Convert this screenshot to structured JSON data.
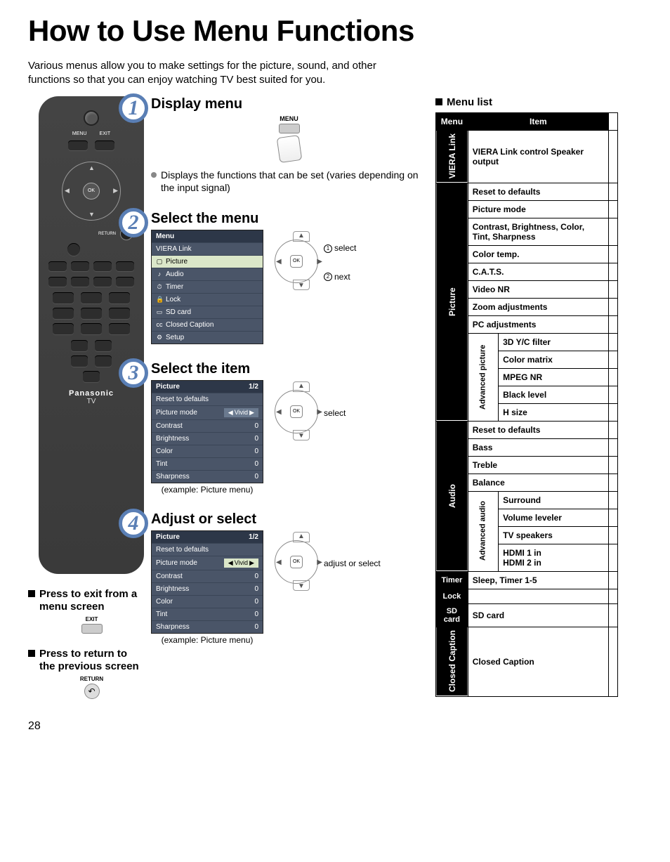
{
  "title": "How to Use Menu Functions",
  "intro": "Various menus allow you to make settings for the picture, sound, and other functions so that you can enjoy watching TV best suited for you.",
  "page_number": "28",
  "remote": {
    "menu_label": "MENU",
    "exit_label": "EXIT",
    "ok_label": "OK",
    "return_label": "RETURN",
    "brand": "Panasonic",
    "sub": "TV"
  },
  "notes": {
    "exit": {
      "text": "Press to exit from a menu screen",
      "btn_label": "EXIT"
    },
    "return": {
      "text": "Press to return to the previous screen",
      "btn_label": "RETURN"
    }
  },
  "steps": {
    "s1": {
      "num": "1",
      "title": "Display menu",
      "menu_label": "MENU",
      "bullet": "Displays the functions that can be set (varies depending on the input signal)"
    },
    "s2": {
      "num": "2",
      "title": "Select the menu",
      "dpad": {
        "label1_num": "1",
        "label1": "select",
        "label2_num": "2",
        "label2": "next"
      },
      "osd": {
        "header": "Menu",
        "items": [
          "VIERA Link",
          "Picture",
          "Audio",
          "Timer",
          "Lock",
          "SD card",
          "Closed Caption",
          "Setup"
        ]
      }
    },
    "s3": {
      "num": "3",
      "title": "Select the item",
      "dpad_label": "select",
      "osd": {
        "header": "Picture",
        "page": "1/2",
        "rows": [
          {
            "label": "Reset to defaults",
            "val": ""
          },
          {
            "label": "Picture mode",
            "val": "Vivid",
            "sel": true
          },
          {
            "label": "Contrast",
            "val": "0"
          },
          {
            "label": "Brightness",
            "val": "0"
          },
          {
            "label": "Color",
            "val": "0"
          },
          {
            "label": "Tint",
            "val": "0"
          },
          {
            "label": "Sharpness",
            "val": "0"
          }
        ],
        "caption": "(example: Picture menu)"
      }
    },
    "s4": {
      "num": "4",
      "title": "Adjust or select",
      "dpad_label": "adjust or select",
      "osd": {
        "header": "Picture",
        "page": "1/2",
        "rows": [
          {
            "label": "Reset to defaults",
            "val": ""
          },
          {
            "label": "Picture mode",
            "val": "Vivid",
            "sel": true,
            "hl": true
          },
          {
            "label": "Contrast",
            "val": "0"
          },
          {
            "label": "Brightness",
            "val": "0"
          },
          {
            "label": "Color",
            "val": "0"
          },
          {
            "label": "Tint",
            "val": "0"
          },
          {
            "label": "Sharpness",
            "val": "0"
          }
        ],
        "caption": "(example: Picture menu)"
      }
    }
  },
  "menu_list": {
    "heading": "Menu list",
    "col_menu": "Menu",
    "col_item": "Item",
    "viera": {
      "cat": "VIERA Link",
      "items": "VIERA Link control Speaker output"
    },
    "picture": {
      "cat": "Picture",
      "items": [
        "Reset to defaults",
        "Picture mode",
        "Contrast, Brightness, Color, Tint, Sharpness",
        "Color temp.",
        "C.A.T.S.",
        "Video NR",
        "Zoom adjustments",
        "PC adjustments"
      ],
      "adv": {
        "cat": "Advanced picture",
        "items": [
          "3D Y/C filter",
          "Color matrix",
          "MPEG NR",
          "Black level",
          "H size"
        ]
      }
    },
    "audio": {
      "cat": "Audio",
      "items": [
        "Reset to defaults",
        "Bass",
        "Treble",
        "Balance"
      ],
      "adv": {
        "cat": "Advanced audio",
        "items": [
          "Surround",
          "Volume leveler",
          "TV speakers",
          "HDMI 1 in\nHDMI 2 in"
        ]
      }
    },
    "timer": {
      "cat": "Timer",
      "item": "Sleep, Timer 1-5"
    },
    "lock": {
      "cat": "Lock",
      "item": ""
    },
    "sd": {
      "cat": "SD card",
      "item": "SD card"
    },
    "cc": {
      "cat": "Closed Caption",
      "item": "Closed Caption"
    }
  }
}
